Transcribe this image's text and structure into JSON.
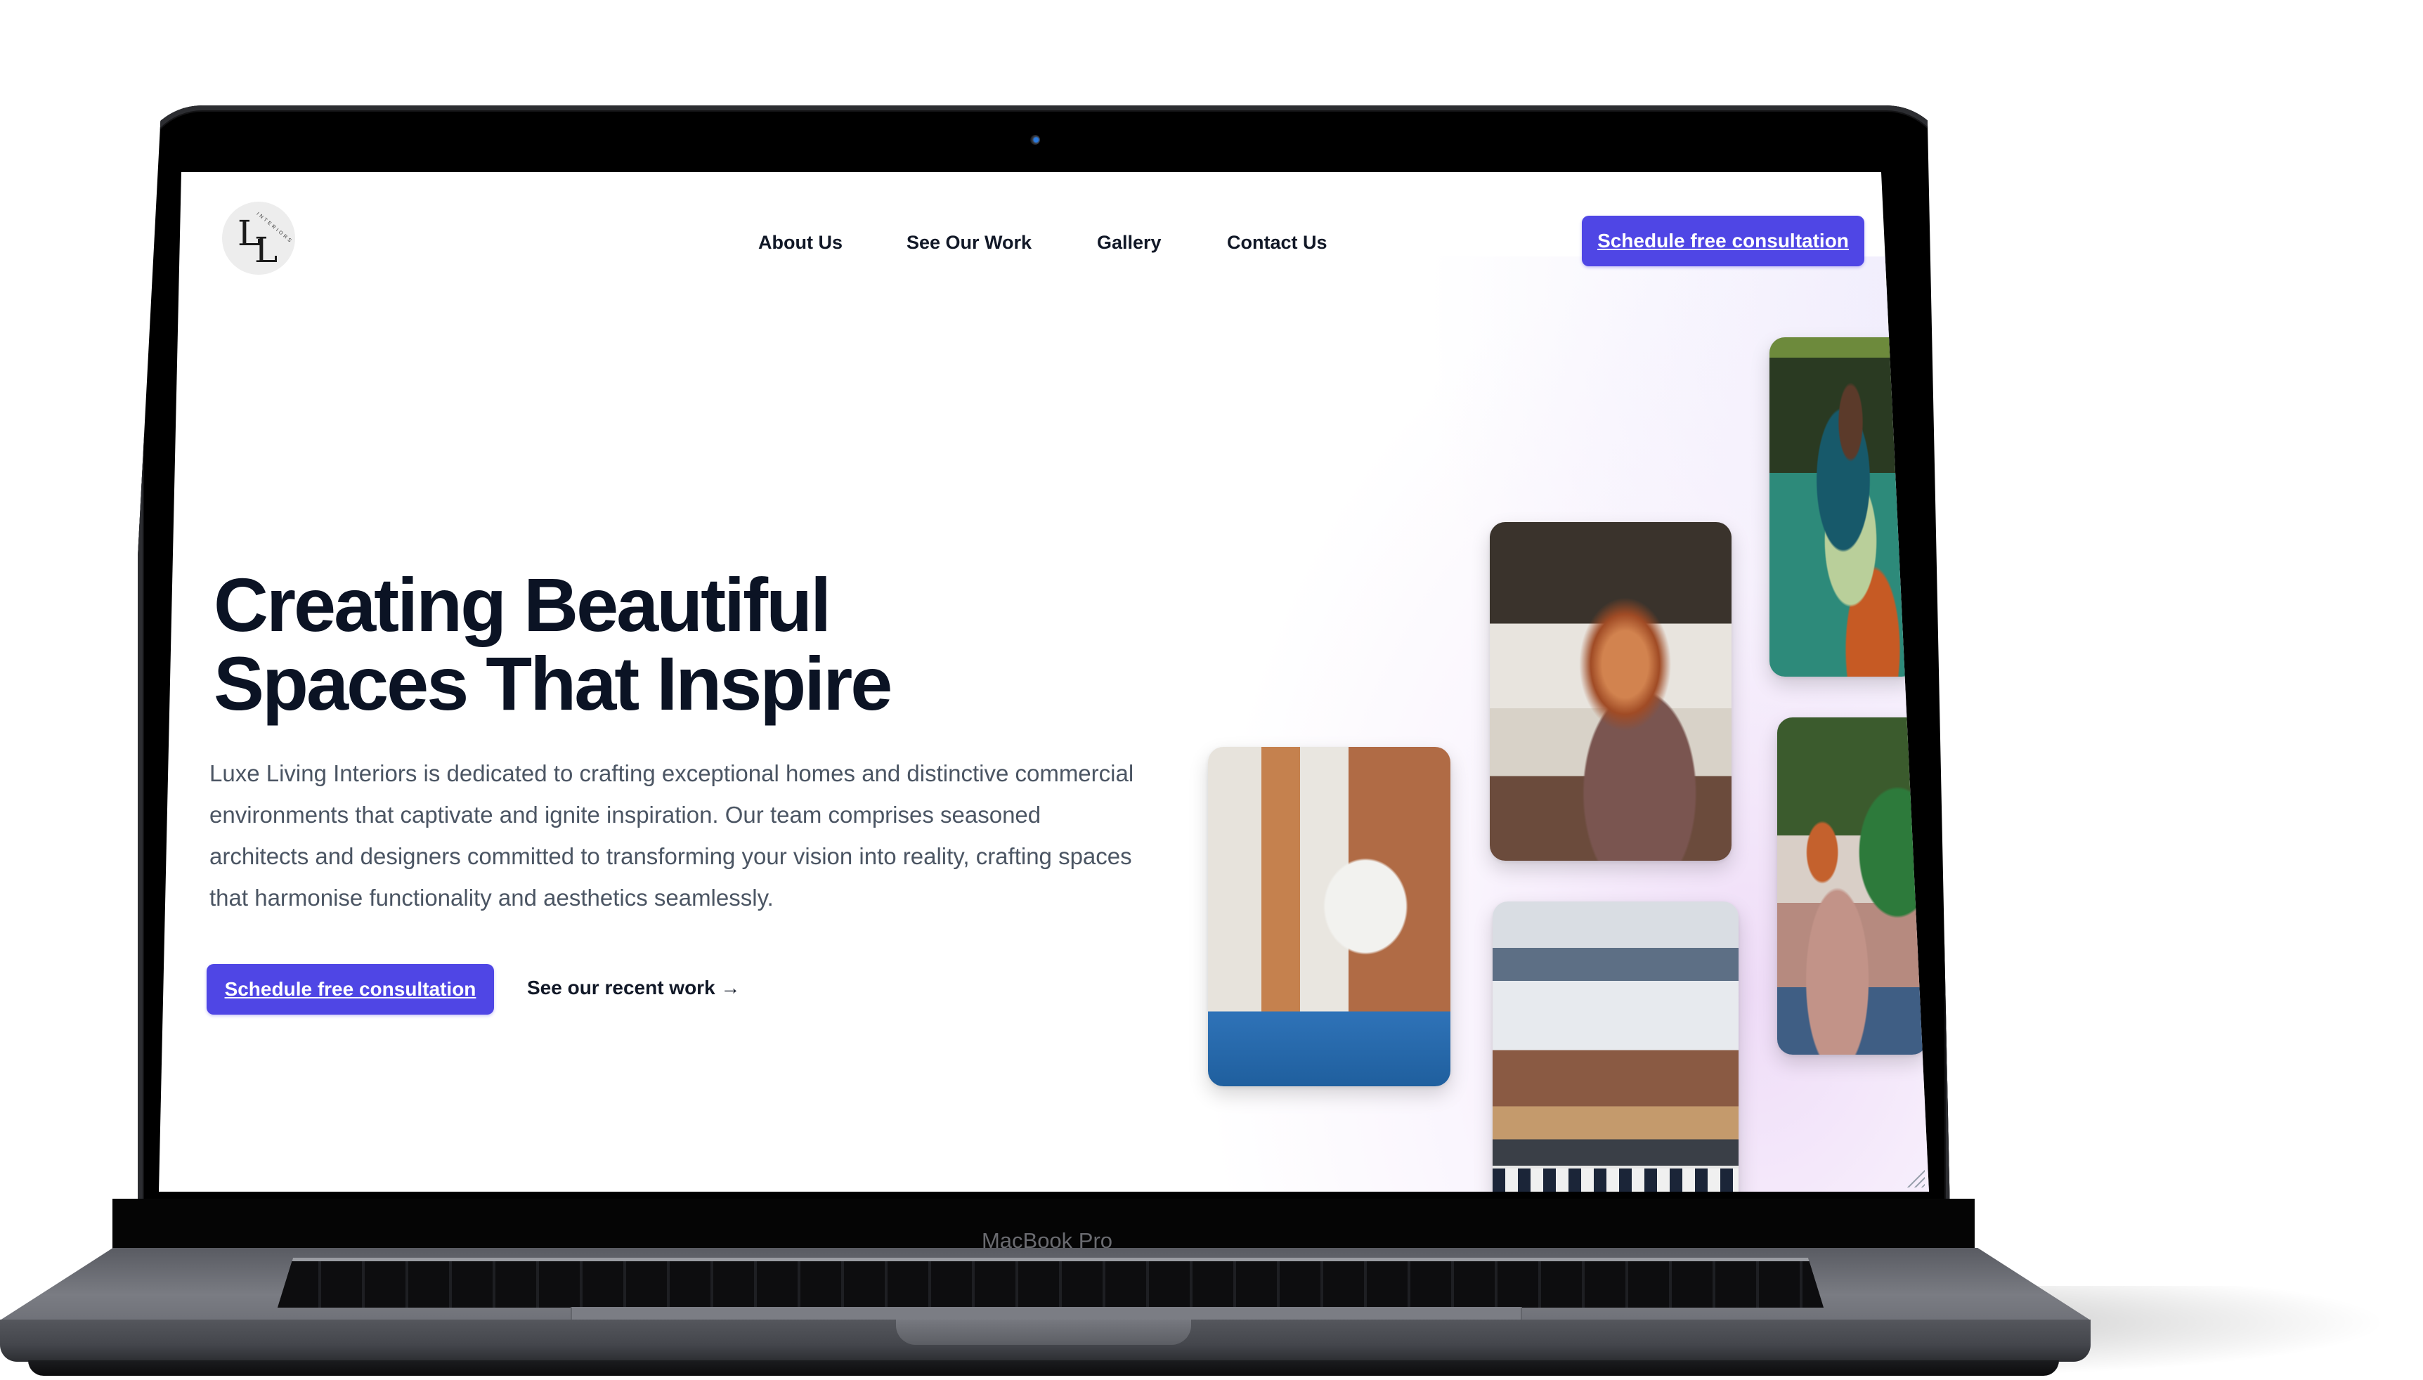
{
  "device": {
    "brand_label": "MacBook Pro"
  },
  "site": {
    "logo": {
      "letters": [
        "L",
        "L"
      ],
      "arc_text": "INTERIORS",
      "alt": "Luxe Living Interiors logo"
    },
    "nav": {
      "items": [
        {
          "label": "About Us"
        },
        {
          "label": "See Our Work"
        },
        {
          "label": "Gallery"
        },
        {
          "label": "Contact Us"
        }
      ],
      "cta_label": "Schedule free consultation"
    },
    "hero": {
      "headline_line1": "Creating Beautiful",
      "headline_line2": "Spaces That Inspire",
      "description": "Luxe Living Interiors is dedicated to crafting exceptional homes and distinctive commercial environments that captivate and ignite inspiration. Our team comprises seasoned architects and designers committed to transforming your vision into reality, crafting spaces that harmonise functionality and aesthetics seamlessly.",
      "primary_cta_label": "Schedule free consultation",
      "secondary_link_label": "See our recent work →"
    },
    "gallery": [
      {
        "name": "team-whiteboard-meeting-photo"
      },
      {
        "name": "woman-with-laptop-photo"
      },
      {
        "name": "open-plan-office-photo"
      },
      {
        "name": "man-laughing-lounge-photo"
      },
      {
        "name": "women-chatting-lounge-photo"
      }
    ],
    "colors": {
      "accent": "#4f46e5",
      "heading": "#0b1324",
      "body_text": "#4b5563",
      "nav_text": "#111827"
    }
  }
}
